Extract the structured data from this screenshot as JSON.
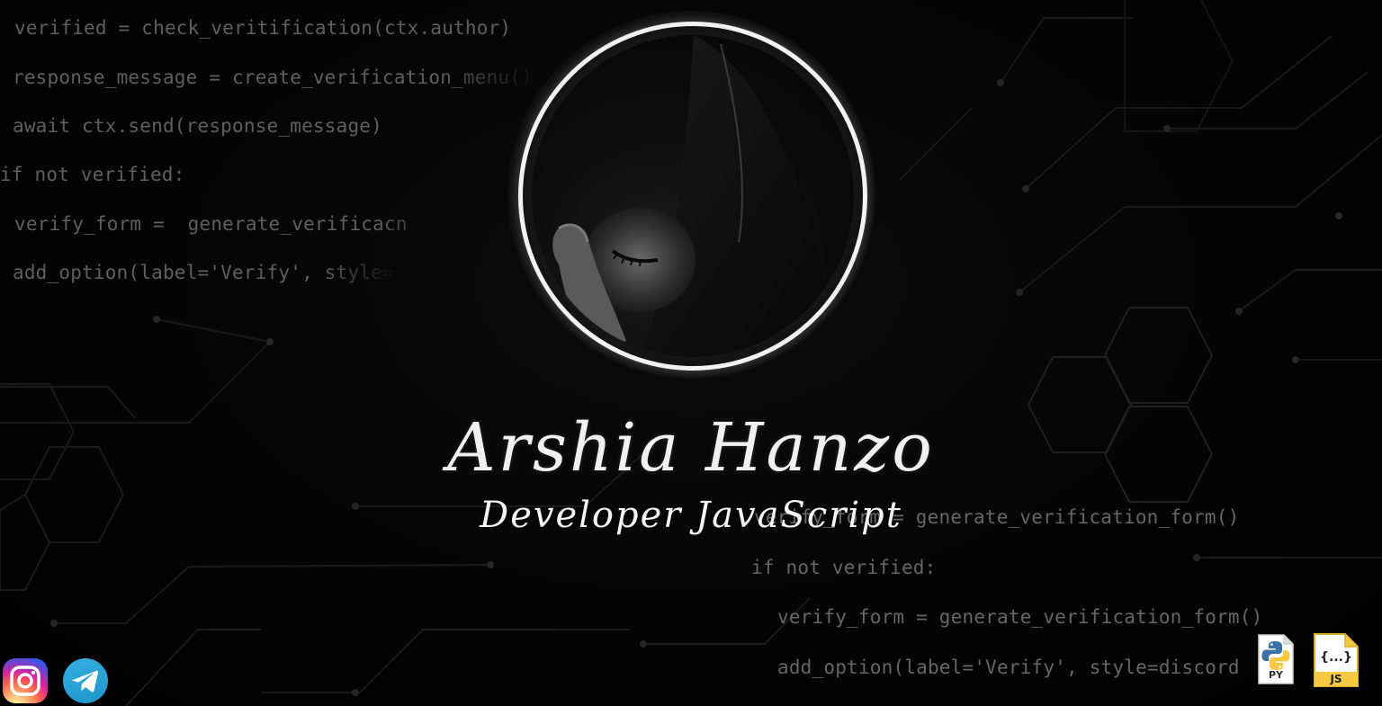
{
  "profile": {
    "name": "Arshia Hanzo",
    "role": "Developer JavaScript"
  },
  "code_left": [
    "verified = check_veritification(ctx.author)",
    "response_message = create_verification_menu()",
    "await ctx.send(response_message)",
    "if not verified:",
    "verify_form =  generate_verificacn",
    "add_option(label='Verify', style="
  ],
  "code_right": [
    "verify_form = generate_verification_form()",
    "if not verified:",
    "verify_form = generate_verification_form()",
    "add_option(label='Verify', style=discord"
  ],
  "social": {
    "instagram_icon": "instagram-icon",
    "telegram_icon": "telegram-icon"
  },
  "badges": {
    "python_label": "PY",
    "js_label": "JS",
    "js_braces": "{...}"
  },
  "colors": {
    "background": "#000000",
    "ring": "#f2f2f2",
    "text": "#f0f0f0",
    "code": "#666666"
  }
}
